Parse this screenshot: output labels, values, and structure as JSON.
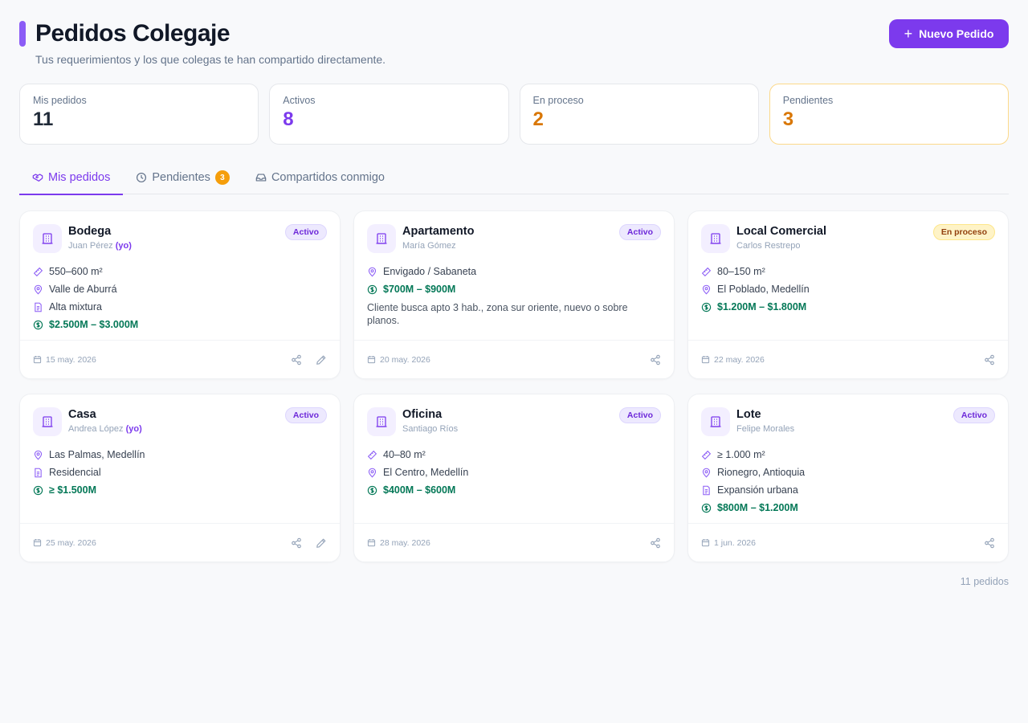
{
  "header": {
    "title": "Pedidos Colegaje",
    "subtitle": "Tus requerimientos y los que colegas te han compartido directamente.",
    "new_button": "Nuevo Pedido"
  },
  "stats": [
    {
      "label": "Mis pedidos",
      "value": "11",
      "color": "#1f2937"
    },
    {
      "label": "Activos",
      "value": "8",
      "color": "#7c3aed"
    },
    {
      "label": "En proceso",
      "value": "2",
      "color": "#d97706"
    },
    {
      "label": "Pendientes",
      "value": "3",
      "color": "#d97706"
    }
  ],
  "tabs": [
    {
      "label": "Mis pedidos",
      "icon": "handshake-icon"
    },
    {
      "label": "Pendientes",
      "icon": "clock-icon",
      "badge": "3"
    },
    {
      "label": "Compartidos conmigo",
      "icon": "inbox-icon"
    }
  ],
  "cards": [
    {
      "title": "Bodega",
      "owner": "Juan Pérez",
      "owner_me": "(yo)",
      "status": "Activo",
      "area": "550–600 m²",
      "location": "Valle de Aburrá",
      "usage": "Alta mixtura",
      "price": "$2.500M – $3.000M",
      "date": "15 may. 2026"
    },
    {
      "title": "Apartamento",
      "owner": "María Gómez",
      "status": "Activo",
      "location": "Envigado / Sabaneta",
      "price": "$700M – $900M",
      "note": "Cliente busca apto 3 hab., zona sur oriente, nuevo o sobre planos.",
      "date": "20 may. 2026"
    },
    {
      "title": "Local Comercial",
      "owner": "Carlos Restrepo",
      "status": "En proceso",
      "area": "80–150 m²",
      "location": "El Poblado, Medellín",
      "price": "$1.200M – $1.800M",
      "date": "22 may. 2026"
    },
    {
      "title": "Casa",
      "owner": "Andrea López",
      "owner_me": "(yo)",
      "status": "Activo",
      "location": "Las Palmas, Medellín",
      "usage": "Residencial",
      "price": "≥ $1.500M",
      "date": "25 may. 2026"
    },
    {
      "title": "Oficina",
      "owner": "Santiago Ríos",
      "status": "Activo",
      "area": "40–80 m²",
      "location": "El Centro, Medellín",
      "price": "$400M – $600M",
      "date": "28 may. 2026"
    },
    {
      "title": "Lote",
      "owner": "Felipe Morales",
      "status": "Activo",
      "area": "≥ 1.000 m²",
      "location": "Rionegro, Antioquia",
      "usage": "Expansión urbana",
      "price": "$800M – $1.200M",
      "date": "1 jun. 2026"
    }
  ],
  "total": "11 pedidos"
}
